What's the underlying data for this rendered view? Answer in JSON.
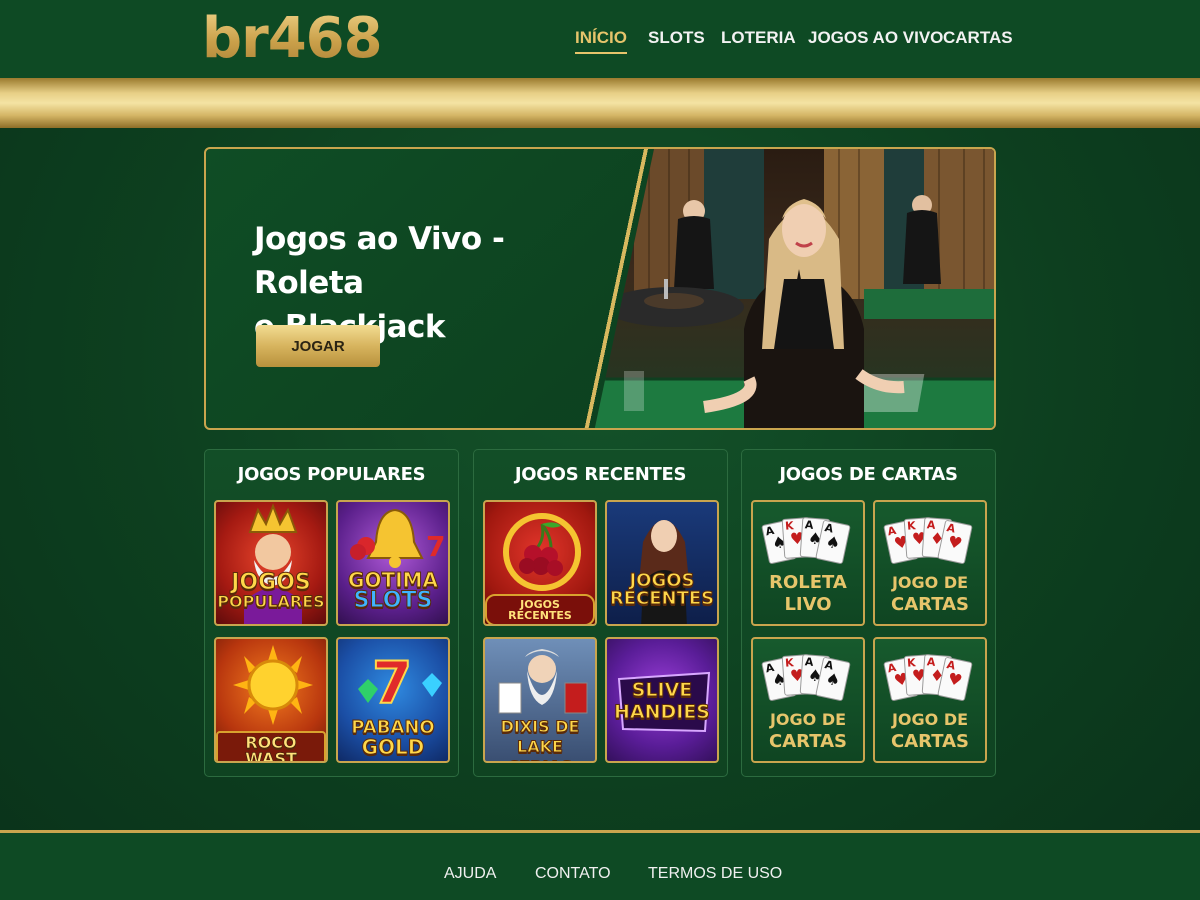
{
  "brand": {
    "logo": "br468"
  },
  "nav": {
    "items": [
      {
        "label": "INÍCIO",
        "active": true
      },
      {
        "label": "SLOTS",
        "active": false
      },
      {
        "label": "LOTERIA",
        "active": false
      },
      {
        "label": "JOGOS AO VIVO",
        "active": false
      },
      {
        "label": "CARTAS",
        "active": false
      }
    ]
  },
  "hero": {
    "title_line1": "Jogos ao Vivo - Roleta",
    "title_line2": "e Blackjack",
    "button_label": "JOGAR"
  },
  "panels": {
    "popular": {
      "title": "JOGOS POPULARES",
      "tiles": [
        {
          "line1": "JOGOS",
          "line2": "POPULARES",
          "icon": "king-icon"
        },
        {
          "line1": "GOTIMA",
          "line2": "SLOTS",
          "icon": "bell-icon"
        },
        {
          "line1": "ROCO WAST",
          "line2": "",
          "icon": "sun-icon"
        },
        {
          "line1": "PABANO",
          "line2": "GOLD",
          "icon": "lucky-seven-icon"
        }
      ]
    },
    "recent": {
      "title": "JOGOS RECENTES",
      "tiles": [
        {
          "line1": "JOGOS RECENTES",
          "line2": "",
          "icon": "cherries-icon"
        },
        {
          "line1": "JOGOS",
          "line2": "RECENTES",
          "icon": "dealer-portrait-icon"
        },
        {
          "line1": "DIXIS DE",
          "line2": "LAKE CERIAS",
          "icon": "zeus-icon"
        },
        {
          "line1": "SLIVE",
          "line2": "HANDIES",
          "icon": "logo-badge-icon"
        }
      ]
    },
    "cards": {
      "title": "JOGOS DE CARTAS",
      "tiles": [
        {
          "line1": "ROLETA",
          "line2": "LIVO",
          "icon": "playing-cards-icon"
        },
        {
          "line1": "JOGO DE",
          "line2": "CARTAS",
          "icon": "playing-cards-icon"
        },
        {
          "line1": "JOGO DE",
          "line2": "CARTAS",
          "icon": "playing-cards-icon"
        },
        {
          "line1": "JOGO DE",
          "line2": "CARTAS",
          "icon": "playing-cards-icon"
        }
      ]
    }
  },
  "footer": {
    "links": [
      "AJUDA",
      "CONTATO",
      "TERMOS DE USO"
    ]
  },
  "colors": {
    "background": "#0d3f1f",
    "header": "#0e4a24",
    "gold": "#c9a54e",
    "nav_active": "#e6c46b"
  }
}
